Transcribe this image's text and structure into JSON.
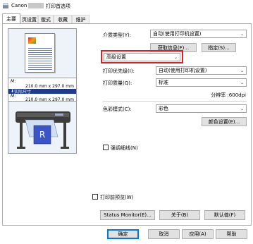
{
  "window": {
    "title_prefix": "Canon",
    "title_suffix": "打印首选项"
  },
  "tabs": [
    "主要",
    "页设置",
    "版式",
    "收藏",
    "维护"
  ],
  "preview": {
    "size_label_1": "M",
    "size_value_1": "210.0 mm x 297.0 mm",
    "actual_size": "实际尺寸",
    "size_label_2": "M",
    "size_value_2": "210.0 mm x 297.0 mm"
  },
  "media_type": {
    "label": "介质类型(Y):",
    "value": "自动(使用打印机设置)"
  },
  "buttons": {
    "get_info": "获取信息(F)...",
    "specify": "指定(S)...",
    "color_settings": "颜色设置(E)...",
    "status_monitor": "Status Monitor(E)...",
    "about": "关于(B)",
    "defaults": "默认值(F)",
    "ok": "确定",
    "cancel": "取消",
    "apply": "应用(A)",
    "help": "帮助"
  },
  "advanced": {
    "value": "高级设置"
  },
  "print_priority": {
    "label": "打印优先级(I):",
    "value": "自动(使用打印机设置)"
  },
  "print_quality": {
    "label": "打印质量(Q):",
    "value": "标准"
  },
  "resolution": "分辨率 :600dpi",
  "color_mode": {
    "label": "色彩模式(C):",
    "value": "彩色"
  },
  "gloss_checkbox": {
    "label": "强调细线(N)",
    "checked": false
  },
  "preview_checkbox": {
    "label": "打印前预览(W)",
    "checked": false
  },
  "colors": {
    "highlight": "#e02020",
    "size_bar": "#1f3b8a"
  }
}
